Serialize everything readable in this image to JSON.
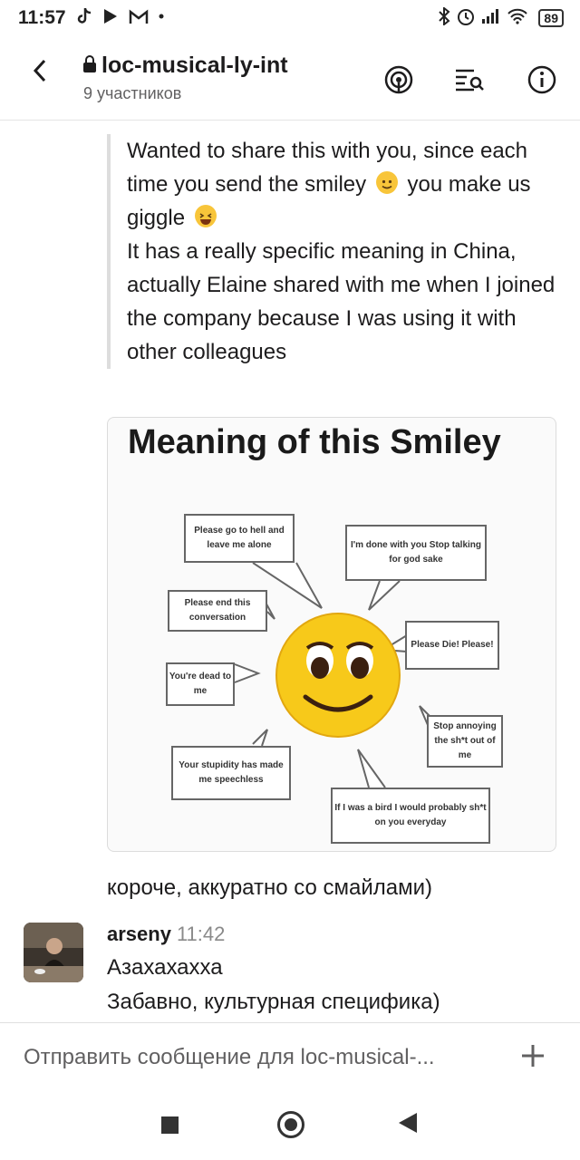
{
  "status_bar": {
    "time": "11:57",
    "battery": "89"
  },
  "header": {
    "channel_name": "loc-musical-ly-int",
    "members": "9 участников"
  },
  "quoted_message": {
    "part1": "Wanted to share this with you, since each time you send the smiley",
    "part2": "you make us giggle",
    "part3": "It has a really specific meaning in China, actually Elaine shared with me when I joined the company because I was using it with other colleagues"
  },
  "image": {
    "title": "Meaning of this Smiley",
    "bubbles": [
      "Please go to hell and leave me alone",
      "I'm done with you Stop talking for god sake",
      "Please end this conversation",
      "Please Die! Please!",
      "You're dead to me",
      "Stop annoying the sh*t out of me",
      "Your stupidity has made me speechless",
      "If I was a bird I would probably sh*t on you everyday"
    ]
  },
  "messages": {
    "plain": "короче, аккуратно со смайлами)",
    "author": "arseny",
    "time": "11:42",
    "line1": "Азахахахха",
    "line2": "Забавно, культурная специфика)"
  },
  "composer": {
    "placeholder": "Отправить сообщение для loc-musical-..."
  }
}
